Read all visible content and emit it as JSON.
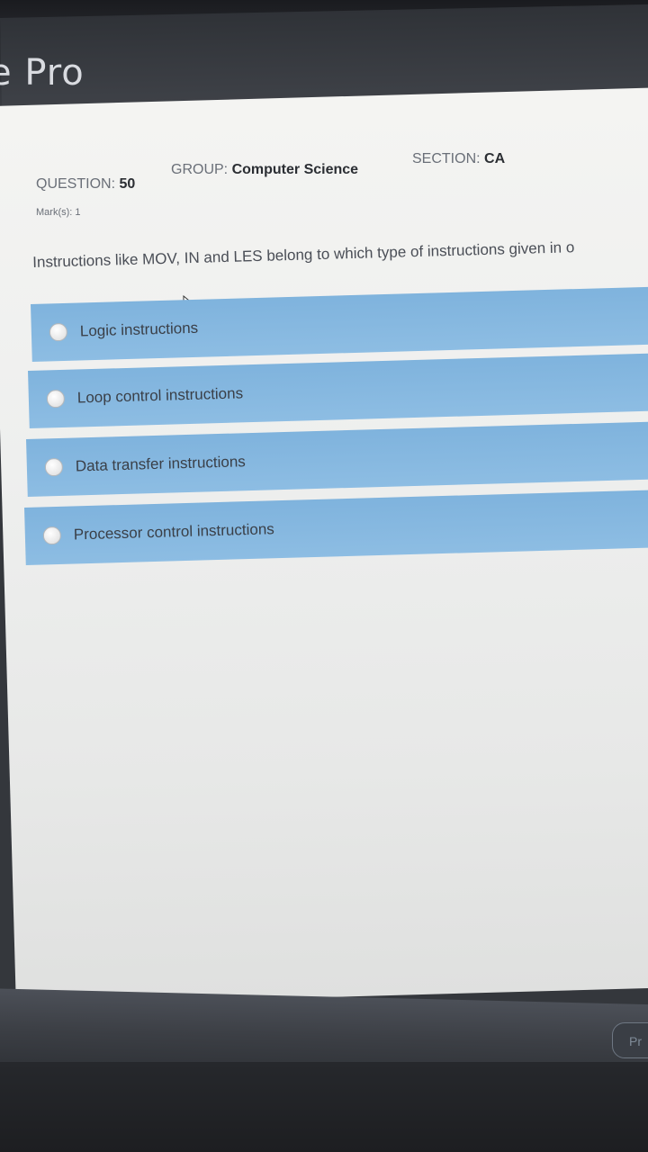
{
  "app": {
    "title": "e Pro"
  },
  "meta": {
    "question_label": "QUESTION:",
    "question_number": "50",
    "group_label": "GROUP:",
    "group_value": "Computer Science",
    "section_label": "SECTION:",
    "section_value": "CA",
    "marks_label": "Mark(s):",
    "marks_value": "1"
  },
  "question": {
    "text": "Instructions like MOV, IN and LES belong to which type of instructions given in o"
  },
  "options": [
    {
      "label": "Logic instructions",
      "selected": false
    },
    {
      "label": "Loop control instructions",
      "selected": false
    },
    {
      "label": "Data transfer instructions",
      "selected": false
    },
    {
      "label": "Processor control instructions",
      "selected": false
    }
  ],
  "footer": {
    "next_label": "Pr"
  },
  "colors": {
    "option_bg": "#8dbde3",
    "page_bg": "#f4f4f2",
    "header_bg": "#3d4046"
  }
}
